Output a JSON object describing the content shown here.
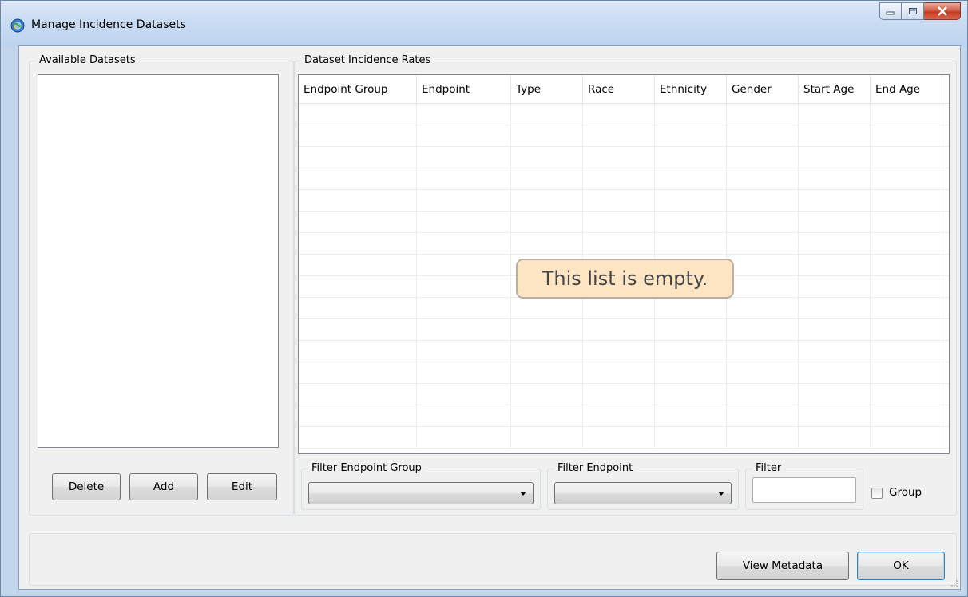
{
  "window": {
    "title": "Manage Incidence Datasets",
    "icon": "globe-app-icon"
  },
  "caption": {
    "minimize_icon": "minimize-icon",
    "maximize_icon": "maximize-icon",
    "close_icon": "close-icon"
  },
  "available_datasets": {
    "legend": "Available Datasets",
    "items": [],
    "buttons": {
      "delete": "Delete",
      "add": "Add",
      "edit": "Edit"
    }
  },
  "incidence_rates": {
    "legend": "Dataset Incidence Rates",
    "columns": [
      "Endpoint Group",
      "Endpoint",
      "Type",
      "Race",
      "Ethnicity",
      "Gender",
      "Start Age",
      "End Age"
    ],
    "rows": [],
    "empty_message": "This list is empty."
  },
  "filters": {
    "endpoint_group": {
      "legend": "Filter Endpoint Group",
      "value": ""
    },
    "endpoint": {
      "legend": "Filter Endpoint",
      "value": ""
    },
    "filter": {
      "legend": "Filter",
      "value": ""
    },
    "group": {
      "label": "Group",
      "checked": false
    }
  },
  "footer": {
    "view_metadata": "View Metadata",
    "ok": "OK"
  },
  "colors": {
    "titlebar": "#c8dbf2",
    "empty_badge_bg": "#fde5c4",
    "close_button": "#c33a20"
  }
}
